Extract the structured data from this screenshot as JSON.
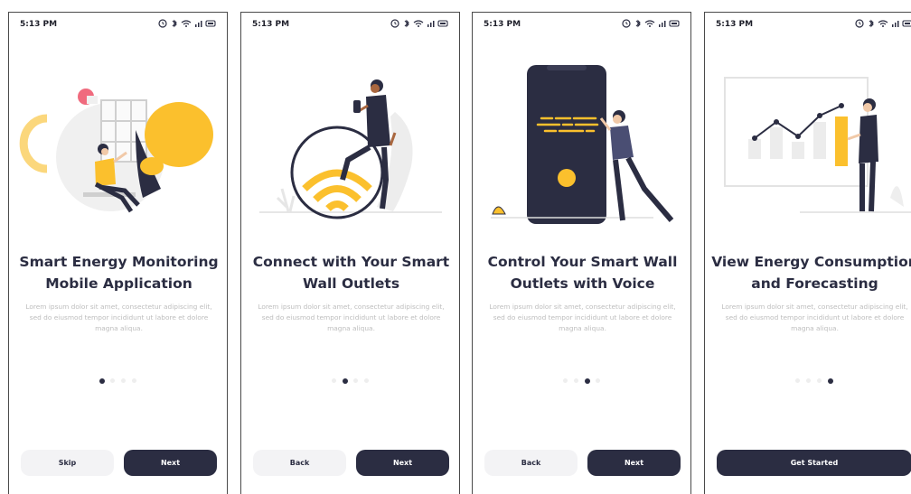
{
  "status_bar": {
    "time": "5:13 PM"
  },
  "screens": [
    {
      "title_line1": "Smart Energy Monitoring",
      "title_line2": "Mobile Application",
      "description": "Lorem ipsum dolor sit amet, consectetur adipiscing elit, sed do eiusmod tempor incididunt ut labore et dolore magna aliqua.",
      "active_dot": 1,
      "left_button": "Skip",
      "right_button": "Next"
    },
    {
      "title_line1": "Connect with Your Smart",
      "title_line2": "Wall Outlets",
      "description": "Lorem ipsum dolor sit amet, consectetur adipiscing elit, sed do eiusmod tempor incididunt ut labore et dolore magna aliqua.",
      "active_dot": 2,
      "left_button": "Back",
      "right_button": "Next"
    },
    {
      "title_line1": "Control Your Smart Wall",
      "title_line2": "Outlets with Voice",
      "description": "Lorem ipsum dolor sit amet, consectetur adipiscing elit, sed do eiusmod tempor incididunt ut labore et dolore magna aliqua.",
      "active_dot": 3,
      "left_button": "Back",
      "right_button": "Next"
    },
    {
      "title_line1": "View Energy Consumption",
      "title_line2": "and Forecasting",
      "description": "Lorem ipsum dolor sit amet, consectetur adipiscing elit, sed do eiusmod tempor incididunt ut labore et dolore magna aliqua.",
      "active_dot": 4,
      "full_button": "Get Started"
    }
  ],
  "page_indicator_count": 4,
  "colors": {
    "accent": "#fbc02d",
    "primary": "#2b2d42",
    "light_button": "#f3f3f5",
    "muted_text": "#bdbdbd"
  }
}
